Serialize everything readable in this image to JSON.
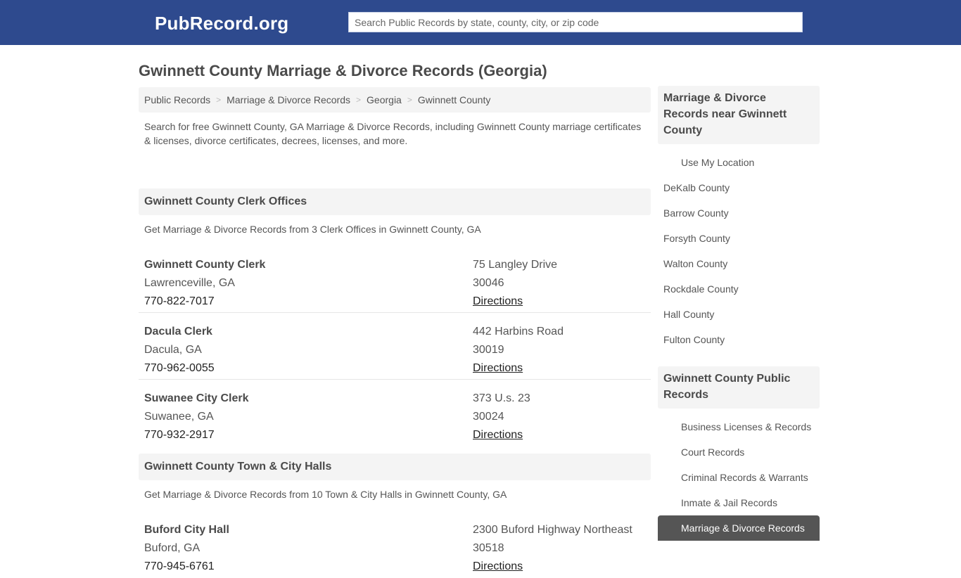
{
  "header": {
    "logo": "PubRecord.org",
    "search_placeholder": "Search Public Records by state, county, city, or zip code",
    "brand_color": "#2e4a8e"
  },
  "page_title": "Gwinnett County Marriage & Divorce Records (Georgia)",
  "breadcrumb": [
    "Public Records",
    "Marriage & Divorce Records",
    "Georgia",
    "Gwinnett County"
  ],
  "breadcrumb_separator": ">",
  "intro": "Search for free Gwinnett County, GA Marriage & Divorce Records, including Gwinnett County marriage certificates & licenses, divorce certificates, decrees, licenses, and more.",
  "sections": [
    {
      "title": "Gwinnett County Clerk Offices",
      "description": "Get Marriage & Divorce Records from 3 Clerk Offices in Gwinnett County, GA",
      "entries": [
        {
          "name": "Gwinnett County Clerk",
          "city": "Lawrenceville, GA",
          "phone": "770-822-7017",
          "address": "75 Langley Drive",
          "zip": "30046",
          "link": "Directions"
        },
        {
          "name": "Dacula Clerk",
          "city": "Dacula, GA",
          "phone": "770-962-0055",
          "address": "442 Harbins Road",
          "zip": "30019",
          "link": "Directions"
        },
        {
          "name": "Suwanee City Clerk",
          "city": "Suwanee, GA",
          "phone": "770-932-2917",
          "address": "373 U.s. 23",
          "zip": "30024",
          "link": "Directions"
        }
      ]
    },
    {
      "title": "Gwinnett County Town & City Halls",
      "description": "Get Marriage & Divorce Records from 10 Town & City Halls in Gwinnett County, GA",
      "entries": [
        {
          "name": "Buford City Hall",
          "city": "Buford, GA",
          "phone": "770-945-6761",
          "address": "2300 Buford Highway Northeast",
          "zip": "30518",
          "link": "Directions"
        }
      ]
    }
  ],
  "sidebar": {
    "nearby_title": "Marriage & Divorce Records near Gwinnett County",
    "use_location": "Use My Location",
    "nearby": [
      "DeKalb County",
      "Barrow County",
      "Forsyth County",
      "Walton County",
      "Rockdale County",
      "Hall County",
      "Fulton County"
    ],
    "public_title": "Gwinnett County Public Records",
    "public_records": [
      "Business Licenses & Records",
      "Court Records",
      "Criminal Records & Warrants",
      "Inmate & Jail Records",
      "Marriage & Divorce Records"
    ],
    "active_item": "Marriage & Divorce Records"
  }
}
